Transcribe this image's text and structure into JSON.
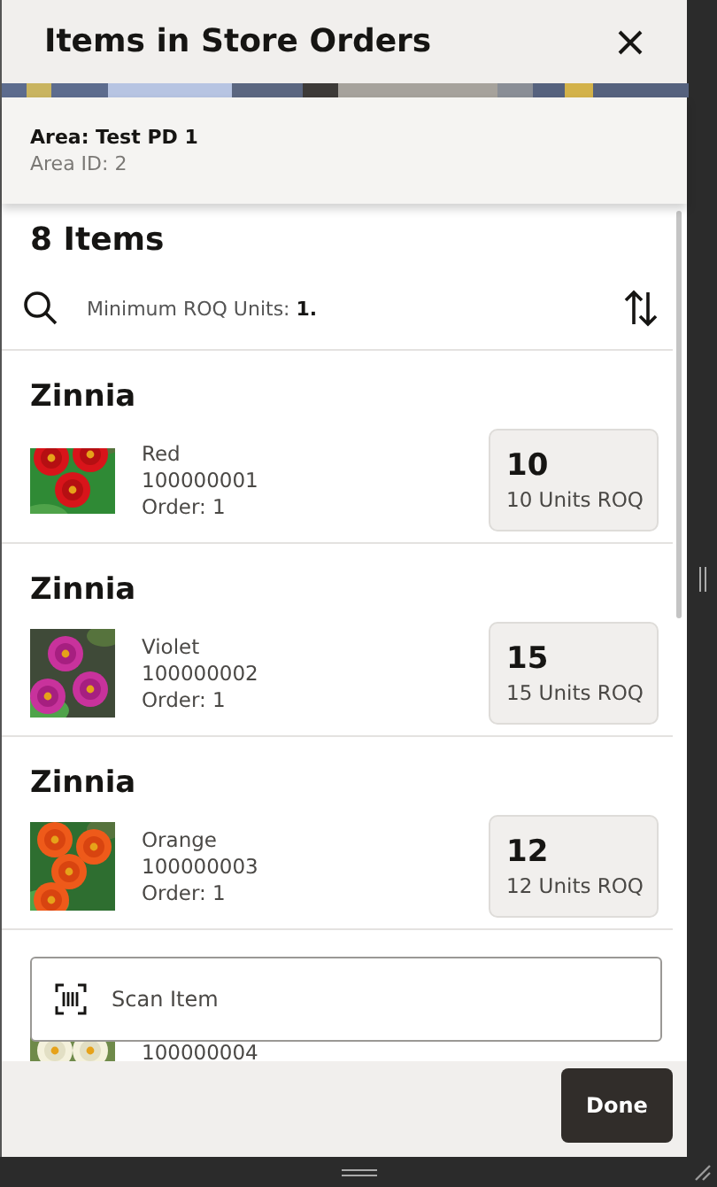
{
  "dialog": {
    "title": "Items in Store Orders",
    "area": {
      "label": "Area:",
      "value": "Test PD 1",
      "id_label": "Area ID: 2"
    }
  },
  "list": {
    "count": "8 Items",
    "filter": {
      "label": "Minimum ROQ Units:",
      "value": "1."
    },
    "items": [
      {
        "name": "Zinnia",
        "variant": "Red",
        "code": "100000001",
        "order": "Order: 1",
        "roq": "10",
        "roq_label": "10 Units ROQ"
      },
      {
        "name": "Zinnia",
        "variant": "Violet",
        "code": "100000002",
        "order": "Order: 1",
        "roq": "15",
        "roq_label": "15 Units ROQ"
      },
      {
        "name": "Zinnia",
        "variant": "Orange",
        "code": "100000003",
        "order": "Order: 1",
        "roq": "12",
        "roq_label": "12 Units ROQ"
      },
      {
        "code": "100000004"
      }
    ]
  },
  "scan": {
    "placeholder": "Scan Item"
  },
  "footer": {
    "button": "Done"
  }
}
